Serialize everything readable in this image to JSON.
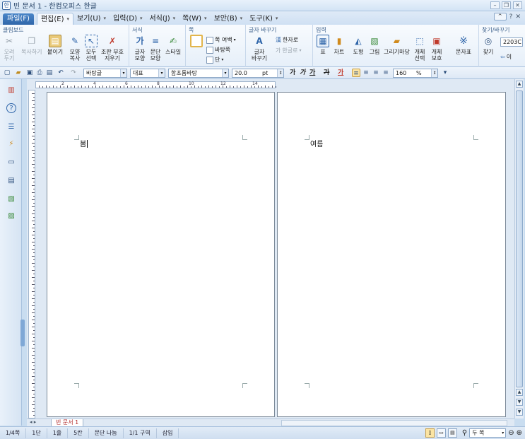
{
  "window": {
    "title": "빈 문서 1 - 한컴오피스 한글"
  },
  "menu": {
    "file": "파일(F)",
    "items": [
      "편집(E)",
      "보기(U)",
      "입력(D)",
      "서식(J)",
      "쪽(W)",
      "보안(B)",
      "도구(K)"
    ],
    "help": "?"
  },
  "ribbon": {
    "groups": {
      "clipboard": "클립보드",
      "format": "서식",
      "page": "쪽",
      "replace": "글자 바꾸기",
      "insert": "입력",
      "find": "찾기/바꾸기"
    },
    "buttons": {
      "cut": "오려\n두기",
      "copy": "복사하기",
      "paste": "붙이기",
      "format_copy": "모양\n복사",
      "select_all": "모두\n선택",
      "erase": "조판 부호\n지우기",
      "char_shape": "글자\n모양",
      "para_shape": "문단\n모양",
      "style": "스타일",
      "page_margin": "쪽 여백",
      "page_bg": "바탕쪽",
      "columns": "단",
      "char_replace": "글자\n바꾸기",
      "hanja": "한자로",
      "hangul": "한글로",
      "table": "표",
      "chart": "차트",
      "shape": "도형",
      "picture": "그림",
      "drawing": "그리기마당",
      "obj_select": "개체\n선택",
      "obj_protect": "개체\n보호",
      "symbol": "문자표",
      "find": "찾기",
      "find_value": "2203C",
      "replace": "이"
    }
  },
  "toolbar": {
    "style_value": "바탕글",
    "lang_value": "대표",
    "font_value": "함초롬바탕",
    "size_value": "20.0",
    "size_unit": "pt",
    "zoom_value": "160",
    "zoom_unit": "%",
    "bold": "가",
    "italic": "가",
    "underline": "가",
    "strike": "가",
    "color": "가"
  },
  "ruler": {
    "numbers": [
      "2",
      "4",
      "6",
      "8",
      "10",
      "12",
      "14"
    ]
  },
  "pages": [
    {
      "text": "봄"
    },
    {
      "text": "여름"
    }
  ],
  "doc_tab": {
    "label": "빈 문서 1"
  },
  "status": {
    "page": "1/4쪽",
    "column": "1단",
    "line": "1줄",
    "char": "5칸",
    "break": "문단 나눔",
    "section": "1/1 구역",
    "mode": "삽입",
    "view": "두 쪽"
  }
}
